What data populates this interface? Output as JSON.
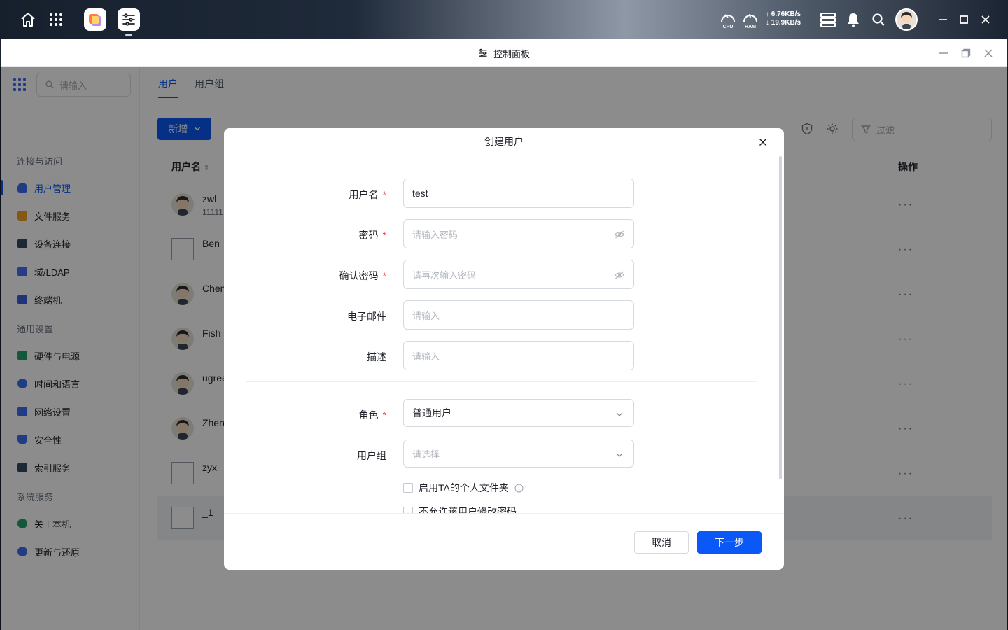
{
  "desktop": {
    "cpu_label": "CPU",
    "ram_label": "RAM",
    "upload_speed": "↑ 6.76KB/s",
    "download_speed": "↓ 19.9KB/s"
  },
  "window": {
    "title": "控制面板"
  },
  "sidebar": {
    "search_placeholder": "请输入",
    "groups": [
      {
        "label": "连接与访问",
        "items": [
          {
            "label": "用户管理",
            "icon": "user-icon",
            "color": "#3b6ef5"
          },
          {
            "label": "文件服务",
            "icon": "folder-icon",
            "color": "#f0a020"
          },
          {
            "label": "设备连接",
            "icon": "device-icon",
            "color": "#34495e"
          },
          {
            "label": "域/LDAP",
            "icon": "ldap-icon",
            "color": "#4a6cf7"
          },
          {
            "label": "终端机",
            "icon": "terminal-icon",
            "color": "#3b5bdb"
          }
        ]
      },
      {
        "label": "通用设置",
        "items": [
          {
            "label": "硬件与电源",
            "icon": "hardware-icon",
            "color": "#22a06b"
          },
          {
            "label": "时间和语言",
            "icon": "globe-icon",
            "color": "#3b6ef5"
          },
          {
            "label": "网络设置",
            "icon": "network-icon",
            "color": "#3b6ef5"
          },
          {
            "label": "安全性",
            "icon": "shield-icon",
            "color": "#3b6ef5"
          },
          {
            "label": "索引服务",
            "icon": "index-icon",
            "color": "#34495e"
          }
        ]
      },
      {
        "label": "系统服务",
        "items": [
          {
            "label": "关于本机",
            "icon": "info-icon",
            "color": "#22a06b"
          },
          {
            "label": "更新与还原",
            "icon": "refresh-icon",
            "color": "#3b6ef5"
          }
        ]
      }
    ]
  },
  "tabs": [
    {
      "label": "用户"
    },
    {
      "label": "用户组"
    }
  ],
  "toolbar": {
    "new_label": "新增",
    "filter_placeholder": "过滤"
  },
  "table": {
    "col_username": "用户名",
    "col_actions": "操作",
    "rows": [
      {
        "name": "zwl",
        "sub": "11111",
        "avatar": "face"
      },
      {
        "name": "Ben",
        "sub": "",
        "avatar": "broken"
      },
      {
        "name": "Chen",
        "sub": "",
        "avatar": "face"
      },
      {
        "name": "Fish",
        "sub": "",
        "avatar": "face"
      },
      {
        "name": "ugree",
        "sub": "",
        "avatar": "face"
      },
      {
        "name": "Zhen",
        "sub": "",
        "avatar": "face"
      },
      {
        "name": "zyx",
        "sub": "",
        "avatar": "broken"
      },
      {
        "name": "_1",
        "sub": "",
        "avatar": "broken"
      }
    ],
    "more_glyph": "···"
  },
  "modal": {
    "title": "创建用户",
    "required_mark": "*",
    "fields": {
      "username": {
        "label": "用户名",
        "value": "test"
      },
      "password": {
        "label": "密码",
        "placeholder": "请输入密码"
      },
      "confirm_password": {
        "label": "确认密码",
        "placeholder": "请再次输入密码"
      },
      "email": {
        "label": "电子邮件",
        "placeholder": "请输入"
      },
      "description": {
        "label": "描述",
        "placeholder": "请输入"
      },
      "role": {
        "label": "角色",
        "value": "普通用户"
      },
      "user_group": {
        "label": "用户组",
        "placeholder": "请选择"
      }
    },
    "checkboxes": [
      {
        "label": "启用TA的个人文件夹"
      },
      {
        "label": "不允许该用户修改密码"
      }
    ],
    "cancel_label": "取消",
    "next_label": "下一步"
  },
  "colors": {
    "accent": "#0a58f5",
    "required": "#e5484d"
  }
}
